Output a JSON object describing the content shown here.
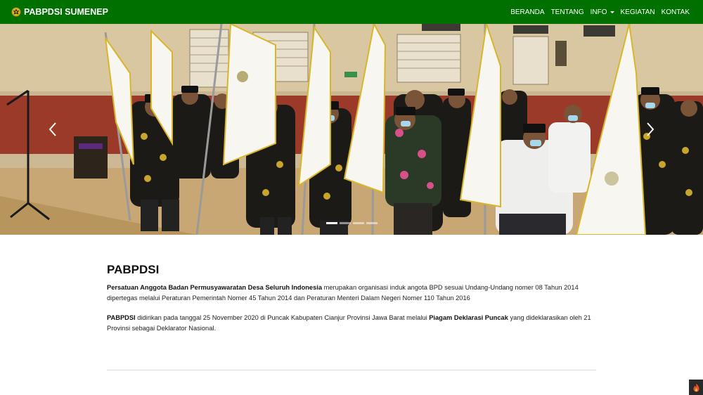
{
  "navbar": {
    "brand": "PABPDSI SUMENEP",
    "logo_icon": "garuda-emblem-icon",
    "items": [
      {
        "label": "BERANDA",
        "dropdown": false
      },
      {
        "label": "TENTANG",
        "dropdown": false
      },
      {
        "label": "INFO",
        "dropdown": true
      },
      {
        "label": "KEGIATAN",
        "dropdown": false
      },
      {
        "label": "KONTAK",
        "dropdown": false
      }
    ],
    "color": "#007000"
  },
  "carousel": {
    "slide_count": 4,
    "active_slide": 1,
    "prev_icon": "chevron-left-icon",
    "next_icon": "chevron-right-icon"
  },
  "content": {
    "title": "PABPDSI",
    "p1_bold": "Persatuan Anggota Badan Permusyawaratan Desa Seluruh Indonesia",
    "p1_rest": " merupakan organisasi induk angota BPD sesuai Undang-Undang nomer 08 Tahun 2014 dipertegas melalui Peraturan Pemerintah Nomer 45 Tahun 2014 dan Peraturan Menteri Dalam Negeri Nomer 110 Tahun 2016",
    "p2_bold1": "PABPDSI",
    "p2_mid": " didirikan pada tanggal 25 November 2020 di Puncak Kabupaten Cianjur Provinsi Jawa Barat melalui ",
    "p2_bold2": "Piagam Deklarasi Puncak",
    "p2_rest": " yang dideklarasikan oleh 21 Provinsi sebagai Deklarator Nasional."
  },
  "corner_button_icon": "flame-icon"
}
